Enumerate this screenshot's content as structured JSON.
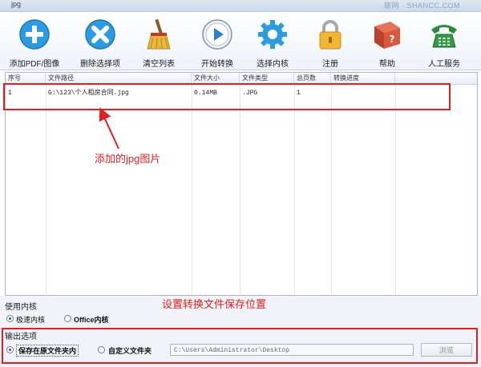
{
  "window": {
    "title": "jpg",
    "watermark": "联网 · SHANCC.COM"
  },
  "toolbar": {
    "buttons": [
      {
        "label": "添加PDF/图像",
        "icon": "plus-icon"
      },
      {
        "label": "删除选择项",
        "icon": "delete-x-icon"
      },
      {
        "label": "清空列表",
        "icon": "broom-icon"
      },
      {
        "label": "开始转换",
        "icon": "play-icon"
      },
      {
        "label": "选择内核",
        "icon": "gear-icon"
      },
      {
        "label": "注册",
        "icon": "lock-icon"
      },
      {
        "label": "帮助",
        "icon": "help-book-icon"
      },
      {
        "label": "人工服务",
        "icon": "telephone-icon"
      }
    ]
  },
  "file_list": {
    "columns": [
      "序号",
      "文件路径",
      "文件大小",
      "文件类型",
      "总页数",
      "转换进度"
    ],
    "rows": [
      {
        "index": "1",
        "path": "G:\\123\\个人租房合同.jpg",
        "size": "0.14MB",
        "type": ".JPG",
        "pages": "1",
        "progress": ""
      }
    ]
  },
  "annotations": {
    "added_file": "添加的jpg图片",
    "save_location": "设置转换文件保存位置"
  },
  "kernel": {
    "section_label": "使用内核",
    "options": [
      {
        "label": "极速内核",
        "selected": true
      },
      {
        "label": "Office内核",
        "selected": false
      }
    ]
  },
  "output": {
    "section_label": "输出选项",
    "options": [
      {
        "label": "保存在原文件夹内",
        "selected": true
      },
      {
        "label": "自定义文件夹",
        "selected": false
      }
    ],
    "path_value": "C:\\Users\\Administrator\\Desktop",
    "browse_label": "浏览"
  },
  "colors": {
    "annotation": "#e02020",
    "accent": "#1e5fb4"
  }
}
